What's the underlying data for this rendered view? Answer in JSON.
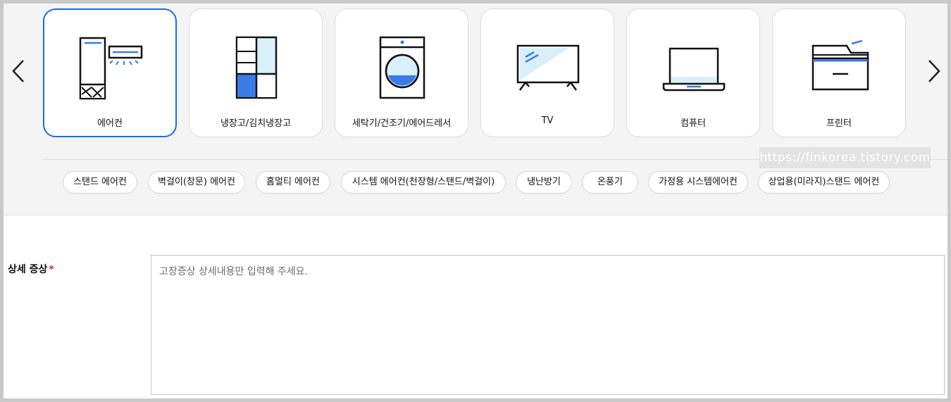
{
  "categories": [
    {
      "label": "에어컨",
      "icon": "air-conditioner-icon",
      "selected": true
    },
    {
      "label": "냉장고/김치냉장고",
      "icon": "refrigerator-icon",
      "selected": false
    },
    {
      "label": "세탁기/건조기/에어드레서",
      "icon": "washing-machine-icon",
      "selected": false
    },
    {
      "label": "TV",
      "icon": "tv-icon",
      "selected": false
    },
    {
      "label": "컴퓨터",
      "icon": "laptop-icon",
      "selected": false
    },
    {
      "label": "프린터",
      "icon": "printer-icon",
      "selected": false
    }
  ],
  "nav": {
    "prev_icon": "chevron-left-icon",
    "next_icon": "chevron-right-icon"
  },
  "watermark": "https://finkorea.tistory.com",
  "subcategories": [
    "스탠드 에어컨",
    "벽걸이(창문) 에어컨",
    "홈멀티 에어컨",
    "시스템 에어컨(천장형/스탠드/벽걸이)",
    "냉난방기",
    "온풍기",
    "가정용 시스템에어컨",
    "상업용(미라지)스탠드 에어컨"
  ],
  "form": {
    "symptom_label": "상세 증상",
    "required_mark": "*",
    "symptom_placeholder": "고장증상 상세내용만 입력해 주세요."
  },
  "colors": {
    "accent": "#1d6ed8",
    "icon_blue": "#3b7be8",
    "icon_light": "#d9f0fb",
    "required": "#d7282f"
  }
}
